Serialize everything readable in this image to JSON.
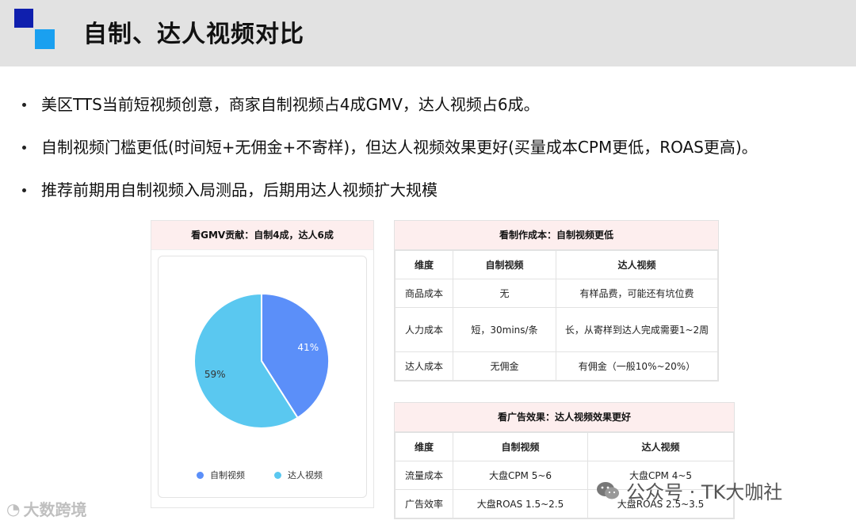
{
  "header": {
    "title": "自制、达人视频对比"
  },
  "bullets": [
    "美区TTS当前短视频创意，商家自制视频占4成GMV，达人视频占6成。",
    "自制视频门槛更低(时间短+无佣金+不寄样)，但达人视频效果更好(买量成本CPM更低，ROAS更高)。",
    "推荐前期用自制视频入局测品，后期用达人视频扩大规模"
  ],
  "pie_card": {
    "title": "看GMV贡献：自制4成，达人6成"
  },
  "chart_data": {
    "type": "pie",
    "title": "看GMV贡献：自制4成，达人6成",
    "categories": [
      "自制视频",
      "达人视频"
    ],
    "values": [
      41,
      59
    ],
    "labels": [
      "41%",
      "59%"
    ],
    "colors": [
      "#5b8ff9",
      "#5ac8f0"
    ],
    "legend": "bottom"
  },
  "table1": {
    "title": "看制作成本：自制视频更低",
    "headers": [
      "维度",
      "自制视频",
      "达人视频"
    ],
    "rows": [
      [
        "商品成本",
        "无",
        "有样品费，可能还有坑位费"
      ],
      [
        "人力成本",
        "短，30mins/条",
        "长，从寄样到达人完成需要1~2周"
      ],
      [
        "达人成本",
        "无佣金",
        "有佣金（一般10%~20%）"
      ]
    ]
  },
  "table2": {
    "title": "看广告效果：达人视频效果更好",
    "headers": [
      "维度",
      "自制视频",
      "达人视频"
    ],
    "rows": [
      [
        "流量成本",
        "大盘CPM 5~6",
        "大盘CPM 4~5"
      ],
      [
        "广告效率",
        "大盘ROAS 1.5~2.5",
        "大盘ROAS 2.5~3.5"
      ]
    ]
  },
  "footer": {
    "left": "大数跨境",
    "right": "公众号 · TK大咖社"
  }
}
